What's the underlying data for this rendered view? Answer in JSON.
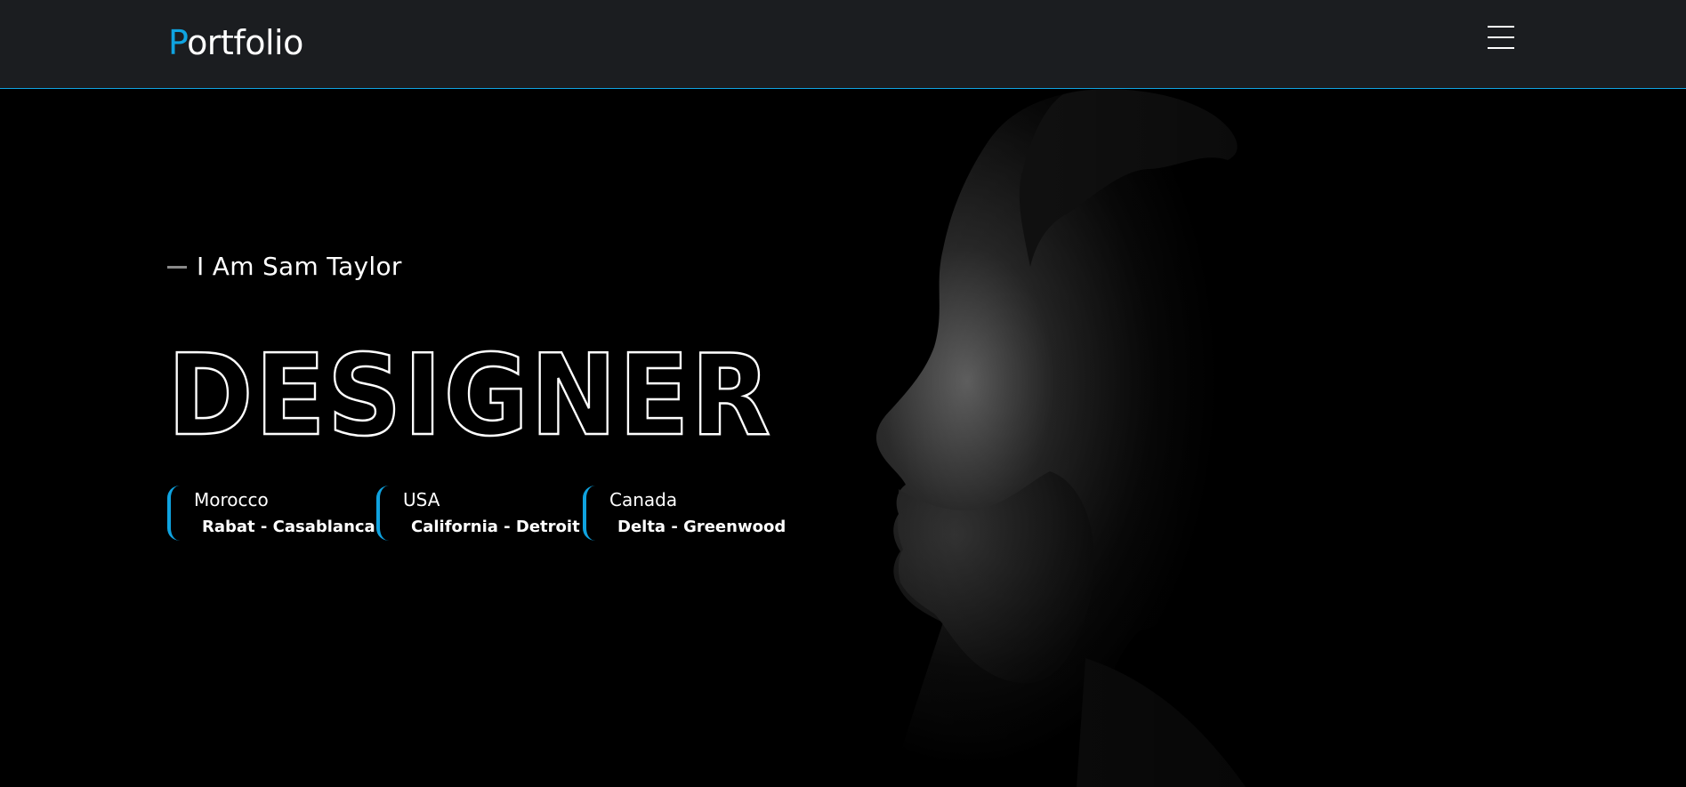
{
  "nav": {
    "logo_initial": "P",
    "logo_rest": "ortfolio",
    "menu_icon": "hamburger-menu-icon"
  },
  "hero": {
    "intro": "I Am Sam Taylor",
    "role": "DESIGNER",
    "locations": [
      {
        "country": "Morocco",
        "cities": "Rabat - Casablanca"
      },
      {
        "country": "USA",
        "cities": "California - Detroit"
      },
      {
        "country": "Canada",
        "cities": "Delta - Greenwood"
      }
    ]
  },
  "colors": {
    "accent": "#0fa3e0",
    "navbar_bg": "#1b1d20",
    "page_bg": "#000000",
    "text": "#ffffff"
  }
}
